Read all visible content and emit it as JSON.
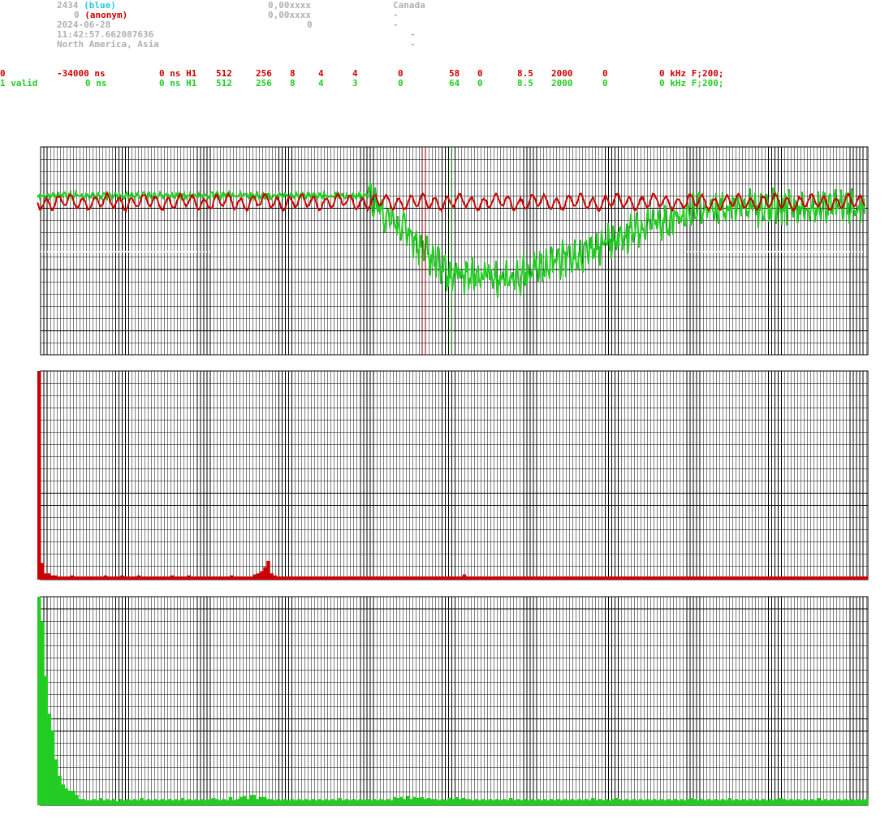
{
  "header": {
    "count": "2434",
    "count_tag": "(blue)",
    "user_num": "0",
    "user_tag": "(anonym)",
    "date": "2024-06-28",
    "time": "11:42:57.662087636",
    "region": "North America, Asia",
    "val1": "0,00xxxx",
    "val2": "0,00xxxx",
    "val3": "0",
    "country": "Canada",
    "dash1": "-",
    "dash2": "-",
    "dash3": "-",
    "dash4": "-"
  },
  "rows": [
    {
      "id": "0",
      "status": "",
      "c1": "-34000 ns",
      "c2": "0 ns H1",
      "c3": "512",
      "c4": "256",
      "c5": "8",
      "c6": "4",
      "c7": "4",
      "c8": "0",
      "c9": "58",
      "c10": "0",
      "c11": "8.5",
      "c12": "2000",
      "c13": "0",
      "c14": "0 kHz F;200;"
    },
    {
      "id": "1",
      "status": "valid",
      "c1": "0 ns",
      "c2": "0 ns H1",
      "c3": "512",
      "c4": "256",
      "c5": "8",
      "c6": "4",
      "c7": "3",
      "c8": "0",
      "c9": "64",
      "c10": "0",
      "c11": "8.5",
      "c12": "2000",
      "c13": "0",
      "c14": "0 kHz F;200;"
    }
  ],
  "colors": {
    "red": "#cc0000",
    "green": "#22cc22",
    "grid": "#000000",
    "marker_red": "#7a0000",
    "marker_green": "#55ee55"
  },
  "chart_data": [
    {
      "type": "line",
      "title": "",
      "series": [
        {
          "color": "#cc0000",
          "profile": "oscillating flat near upper band"
        },
        {
          "color": "#22cc22",
          "profile": "flat then deep dip in middle, recovering to right"
        }
      ],
      "markers": [
        "red vertical at ~46%",
        "green vertical at ~50%"
      ],
      "grid": true
    },
    {
      "type": "bar",
      "title": "",
      "color": "#cc0000",
      "values": [
        100,
        8,
        3,
        3,
        2,
        2,
        1.5,
        1.5,
        1.5,
        1.5,
        2,
        1.5,
        1.5,
        1.5,
        1.5,
        1.5,
        1.5,
        1.5,
        1.5,
        1.5,
        2,
        1.5,
        1.5,
        1.5,
        1.5,
        2,
        1.5,
        1.5,
        1.5,
        1.5,
        2,
        1.5,
        1.5,
        1.5,
        1.5,
        1.5,
        1.5,
        1.5,
        1.5,
        1.5,
        2,
        1.5,
        1.5,
        1.5,
        1.5,
        2,
        1.5,
        1.5,
        1.5,
        1.5,
        1.5,
        1.5,
        1.5,
        1.5,
        1.5,
        1.5,
        1.5,
        1.5,
        2,
        1.5,
        1.5,
        1.5,
        1.5,
        1.5,
        1.5,
        2.5,
        3,
        4,
        6,
        9,
        3,
        2,
        1.5,
        1.5,
        1.5,
        1.5,
        1.5,
        1.5,
        1.5,
        1.5,
        1.5,
        1.5,
        1.5,
        1.5,
        1.5,
        1.5,
        1.5,
        1.5,
        1.5,
        1.5,
        1.5,
        1.5,
        1.5,
        1.5,
        1.5,
        1.5,
        1.5,
        1.5,
        1.5,
        1.5,
        1.5,
        1.5,
        1.5,
        1.5,
        1.5,
        1.5,
        1.5,
        1.5,
        1.5,
        1.5,
        1.5,
        1.5,
        1.5,
        1.5,
        1.5,
        1.5,
        1.5,
        1.5,
        1.5,
        1.5,
        1.5,
        1.5,
        1.5,
        1.5,
        1.5,
        1.5,
        1.5,
        1.5,
        2.5,
        1.5,
        1.5,
        1.5,
        1.5,
        1.5,
        1.5,
        1.5,
        1.5,
        1.5,
        1.5,
        1.5,
        1.5,
        1.5,
        1.5,
        1.5,
        1.5,
        1.5,
        1.5,
        1.5,
        1.5,
        1.5,
        1.5,
        1.5,
        1.5,
        1.5,
        1.5,
        1.5,
        1.5,
        1.5,
        1.5,
        1.5,
        1.5,
        1.5,
        1.5,
        1.5,
        1.5,
        1.5,
        1.5,
        1.5,
        1.5,
        1.5,
        1.5,
        1.5,
        1.5,
        1.5,
        1.5,
        1.5,
        1.5,
        1.5,
        1.5,
        1.5,
        1.5,
        1.5,
        1.5,
        1.5,
        1.5,
        1.5,
        1.5,
        1.5,
        1.5,
        1.5,
        1.5,
        1.5,
        1.5,
        1.5,
        1.5,
        1.5,
        1.5,
        1.5,
        1.5,
        1.5,
        1.5,
        1.5,
        1.5,
        1.5,
        1.5,
        1.5,
        1.5,
        1.5,
        1.5,
        1.5,
        1.5,
        1.5,
        1.5,
        1.5,
        1.5,
        1.5,
        1.5,
        1.5,
        1.5,
        1.5,
        1.5,
        1.5,
        1.5,
        1.5,
        1.5,
        1.5,
        1.5,
        1.5,
        1.5,
        1.5,
        1.5,
        1.5,
        1.5,
        1.5,
        1.5,
        1.5,
        1.5,
        1.5,
        1.5,
        1.5,
        1.5,
        1.5,
        1.5,
        1.5,
        1.5,
        1.5,
        1.5,
        1.5,
        1.5,
        1.5
      ],
      "grid": true
    },
    {
      "type": "bar",
      "title": "",
      "color": "#22cc22",
      "values": [
        100,
        88,
        62,
        44,
        36,
        22,
        14,
        10,
        8,
        7,
        7,
        5,
        3,
        3,
        2.5,
        2.5,
        3,
        2.5,
        3.5,
        2.5,
        3,
        2.5,
        3,
        2,
        3,
        2.5,
        3,
        2.5,
        3,
        2.5,
        3.5,
        2.5,
        3,
        2.5,
        3,
        2.5,
        3,
        2.5,
        3,
        2.5,
        3,
        2.5,
        3.5,
        2.5,
        3,
        2.5,
        3,
        2.5,
        3,
        2.5,
        3,
        3.5,
        3,
        2.5,
        3,
        2.5,
        4,
        2.5,
        3,
        4,
        4.5,
        3,
        5,
        5,
        3,
        4,
        4,
        3,
        3,
        2.5,
        3,
        2.5,
        3,
        2.5,
        3,
        2.5,
        3,
        2.5,
        3,
        2.5,
        3,
        2.5,
        3,
        2.5,
        3,
        2.5,
        3,
        2.5,
        3.5,
        2.5,
        3,
        2.5,
        3,
        2.5,
        3,
        2.5,
        3,
        2.5,
        3,
        2.5,
        3,
        2.5,
        3,
        2.5,
        4,
        3.5,
        4,
        3,
        4.5,
        3,
        4,
        3.5,
        4,
        3,
        3.5,
        3,
        3,
        2.5,
        3,
        2.5,
        3.5,
        3,
        4,
        3,
        3.5,
        3,
        3,
        2.5,
        3,
        2.5,
        3,
        2.5,
        3,
        2.5,
        3,
        2.5,
        3,
        2.5,
        3.5,
        2.5,
        3,
        2.5,
        3,
        2.5,
        3,
        2.5,
        3,
        2.5,
        3,
        2.5,
        3,
        2.5,
        3,
        2.5,
        3,
        2.5,
        3,
        2.5,
        3,
        2.5,
        3,
        2.5,
        3.5,
        2.5,
        3,
        2.5,
        3,
        2.5,
        3,
        3.5,
        3,
        2.5,
        3,
        2.5,
        3,
        2.5,
        3,
        2.5,
        3,
        2.5,
        3,
        2.5,
        3,
        2.5,
        3,
        2.5,
        3,
        2.5,
        3,
        2.5,
        3,
        3.5,
        3,
        2.5,
        3,
        2.5,
        3,
        2.5,
        3,
        2.5,
        3,
        2.5,
        3.5,
        2.5,
        3,
        2.5,
        3,
        2.5,
        3,
        2.5,
        3,
        2.5,
        3,
        2.5,
        3,
        2.5,
        3,
        3.5,
        3,
        2.5,
        3,
        2.5,
        3,
        2.5,
        3,
        2.5,
        3,
        2.5,
        3.5,
        2.5,
        3,
        2.5,
        3,
        2.5,
        3,
        2.5,
        3,
        2.5,
        3,
        2.5,
        3,
        2.5,
        3
      ],
      "grid": true
    }
  ]
}
